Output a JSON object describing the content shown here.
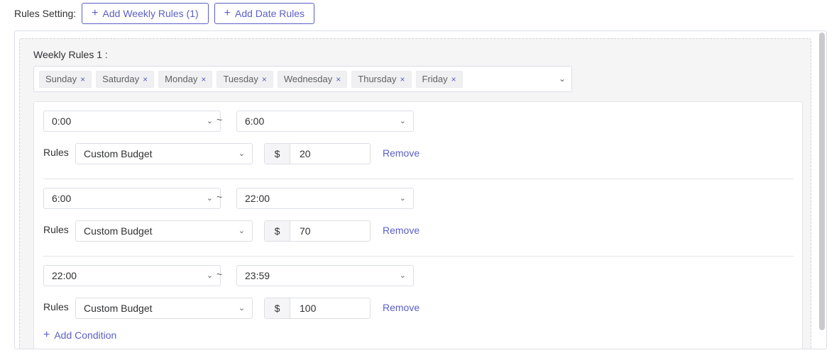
{
  "header": {
    "label": "Rules Setting:",
    "add_weekly_label": "Add Weekly Rules (1)",
    "add_date_label": "Add Date Rules",
    "plus": "+"
  },
  "weekly": {
    "title": "Weekly Rules 1 :",
    "days": [
      "Sunday",
      "Saturday",
      "Monday",
      "Tuesday",
      "Wednesday",
      "Thursday",
      "Friday"
    ],
    "tag_close": "×"
  },
  "rules": [
    {
      "start": "0:00",
      "end": "6:00",
      "type": "Custom Budget",
      "currency": "$",
      "amount": "20"
    },
    {
      "start": "6:00",
      "end": "22:00",
      "type": "Custom Budget",
      "currency": "$",
      "amount": "70"
    },
    {
      "start": "22:00",
      "end": "23:59",
      "type": "Custom Budget",
      "currency": "$",
      "amount": "100"
    }
  ],
  "labels": {
    "tilde": "~",
    "rules": "Rules",
    "remove": "Remove",
    "add_condition": "Add Condition"
  },
  "colors": {
    "accent": "#5b5fc7",
    "border": "#dcdfe6",
    "panel_bg": "#f5f5f6"
  }
}
